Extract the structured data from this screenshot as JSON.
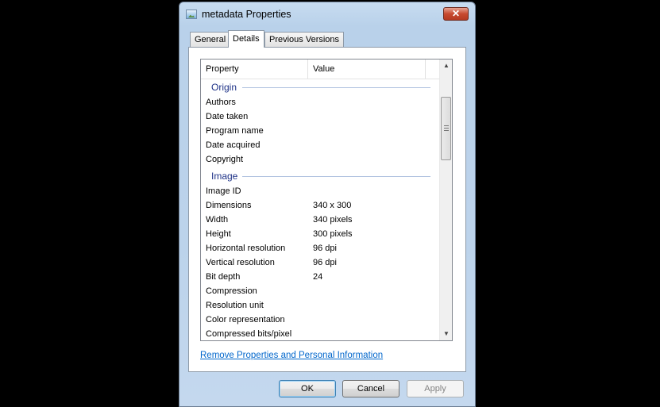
{
  "window": {
    "title": "metadata Properties",
    "close_symbol": "✕"
  },
  "tabs": [
    {
      "label": "General"
    },
    {
      "label": "Details"
    },
    {
      "label": "Previous Versions"
    }
  ],
  "list": {
    "columns": {
      "property": "Property",
      "value": "Value"
    },
    "groups": [
      {
        "name": "Origin",
        "rows": [
          {
            "property": "Authors",
            "value": ""
          },
          {
            "property": "Date taken",
            "value": ""
          },
          {
            "property": "Program name",
            "value": ""
          },
          {
            "property": "Date acquired",
            "value": ""
          },
          {
            "property": "Copyright",
            "value": ""
          }
        ]
      },
      {
        "name": "Image",
        "rows": [
          {
            "property": "Image ID",
            "value": ""
          },
          {
            "property": "Dimensions",
            "value": "340 x 300"
          },
          {
            "property": "Width",
            "value": "340 pixels"
          },
          {
            "property": "Height",
            "value": "300 pixels"
          },
          {
            "property": "Horizontal resolution",
            "value": "96 dpi"
          },
          {
            "property": "Vertical resolution",
            "value": "96 dpi"
          },
          {
            "property": "Bit depth",
            "value": "24"
          },
          {
            "property": "Compression",
            "value": ""
          },
          {
            "property": "Resolution unit",
            "value": ""
          },
          {
            "property": "Color representation",
            "value": ""
          },
          {
            "property": "Compressed bits/pixel",
            "value": ""
          }
        ]
      }
    ]
  },
  "remove_link": "Remove Properties and Personal Information",
  "buttons": {
    "ok": "OK",
    "cancel": "Cancel",
    "apply": "Apply"
  },
  "icons": {
    "scroll_up": "▲",
    "scroll_down": "▼"
  }
}
